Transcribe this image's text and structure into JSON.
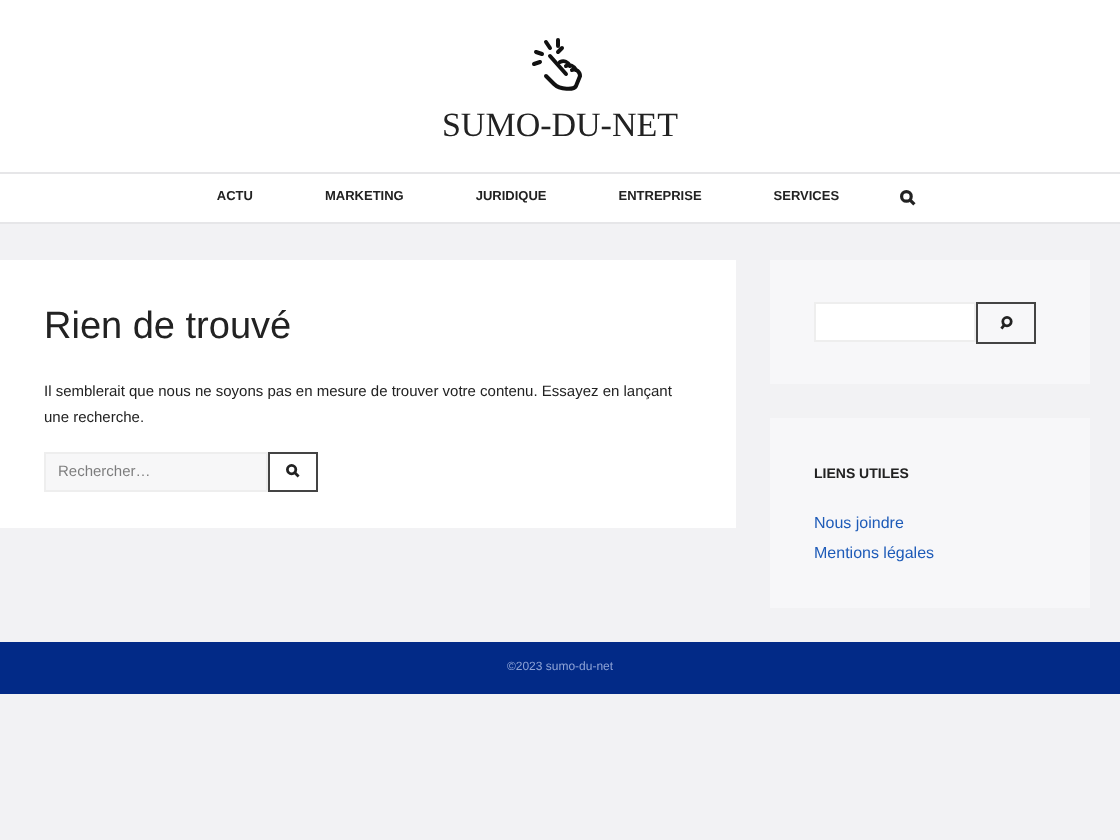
{
  "site": {
    "title": "SUMO-DU-NET"
  },
  "nav": {
    "items": [
      {
        "label": "ACTU"
      },
      {
        "label": "MARKETING"
      },
      {
        "label": "JURIDIQUE"
      },
      {
        "label": "ENTREPRISE"
      },
      {
        "label": "SERVICES"
      }
    ]
  },
  "main": {
    "heading": "Rien de trouvé",
    "message": "Il semblerait que nous ne soyons pas en mesure de trouver votre contenu. Essayez en lançant une recherche.",
    "search": {
      "placeholder": "Rechercher…"
    }
  },
  "sidebar": {
    "links_title": "LIENS UTILES",
    "links": [
      {
        "label": "Nous joindre"
      },
      {
        "label": "Mentions légales"
      }
    ]
  },
  "footer": {
    "text": "©2023 sumo-du-net"
  }
}
